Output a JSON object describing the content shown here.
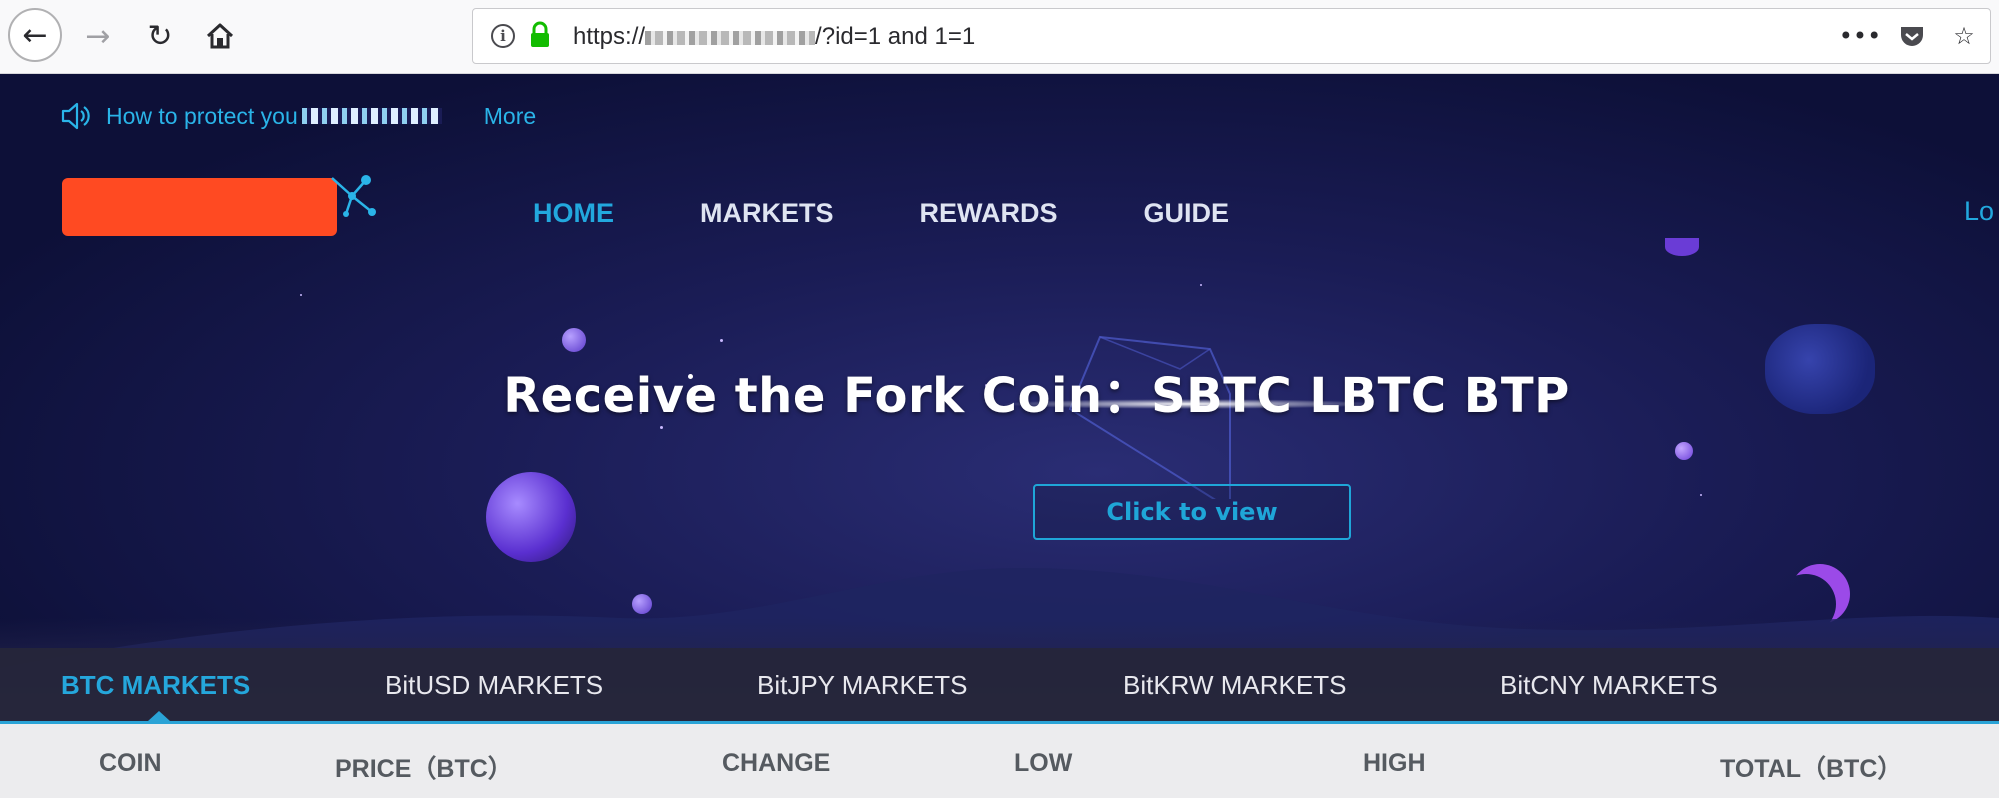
{
  "browser": {
    "url_prefix": "https://",
    "url_suffix": "/?id=1 and 1=1",
    "icons": [
      "back-arrow-icon",
      "forward-arrow-icon",
      "reload-icon",
      "home-icon",
      "info-icon",
      "lock-icon",
      "more-icon",
      "pocket-icon",
      "star-icon"
    ]
  },
  "ticker": {
    "text": "How to protect you",
    "more": "More"
  },
  "nav": {
    "items": [
      {
        "label": "HOME",
        "active": true
      },
      {
        "label": "MARKETS",
        "active": false
      },
      {
        "label": "REWARDS",
        "active": false
      },
      {
        "label": "GUIDE",
        "active": false
      }
    ],
    "login": "Lo"
  },
  "hero": {
    "title": "Receive the Fork Coin：SBTC  LBTC  BTP",
    "button": "Click to view"
  },
  "markets": {
    "tabs": [
      {
        "label": "BTC MARKETS",
        "active": true
      },
      {
        "label": "BitUSD MARKETS",
        "active": false
      },
      {
        "label": "BitJPY MARKETS",
        "active": false
      },
      {
        "label": "BitKRW MARKETS",
        "active": false
      },
      {
        "label": "BitCNY MARKETS",
        "active": false
      }
    ],
    "columns": [
      "COIN",
      "PRICE（BTC）",
      "CHANGE",
      "LOW",
      "HIGH",
      "TOTAL（BTC）"
    ]
  },
  "colors": {
    "accent": "#22a8de",
    "logo_redaction": "#ff4a22",
    "hero_bg": "#1a1c55"
  }
}
